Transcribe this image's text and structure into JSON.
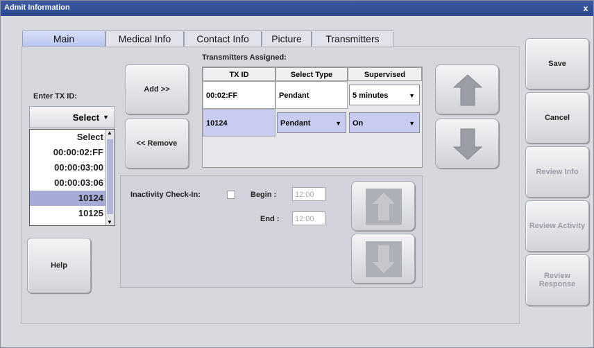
{
  "window": {
    "title": "Admit Information",
    "close_glyph": "x"
  },
  "tabs": [
    {
      "label": "Main",
      "active": true
    },
    {
      "label": "Medical Info",
      "active": false
    },
    {
      "label": "Contact Info",
      "active": false
    },
    {
      "label": "Picture",
      "active": false
    },
    {
      "label": "Transmitters",
      "active": false
    }
  ],
  "tx_entry": {
    "label": "Enter TX ID:",
    "select_value": "Select",
    "list": [
      "Select",
      "00:00:02:FF",
      "00:00:03:00",
      "00:00:03:06",
      "10124",
      "10125"
    ],
    "selected_item": "10124"
  },
  "buttons": {
    "add": "Add >>",
    "remove": "<< Remove",
    "help": "Help",
    "save": "Save",
    "cancel": "Cancel",
    "review_info": "Review Info",
    "review_activity": "Review Activity",
    "review_response": "Review Response"
  },
  "transmitters": {
    "title": "Transmitters Assigned:",
    "headers": [
      "TX ID",
      "Select Type",
      "Supervised"
    ],
    "rows": [
      {
        "tx_id": "00:02:FF",
        "type": "Pendant",
        "supervised": "5 minutes"
      },
      {
        "tx_id": "10124",
        "type": "Pendant",
        "supervised": "On"
      }
    ]
  },
  "inactivity": {
    "label": "Inactivity Check-In:",
    "checked": false,
    "begin_label": "Begin :",
    "begin_value": "12:00",
    "end_label": "End :",
    "end_value": "12:00"
  },
  "colors": {
    "accent": "#3d5aa0",
    "selection": "#a5aad6"
  }
}
